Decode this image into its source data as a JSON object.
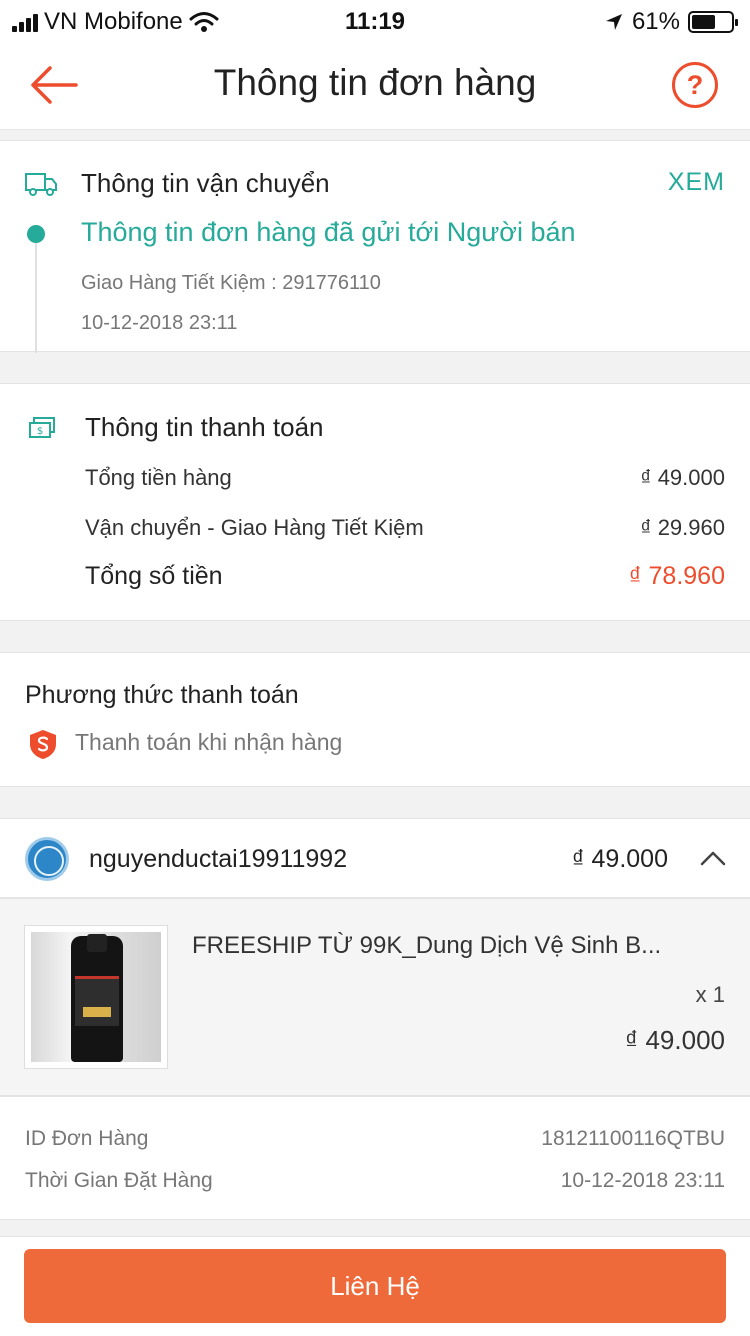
{
  "status_bar": {
    "carrier": "VN Mobifone",
    "time": "11:19",
    "battery": "61%",
    "battery_level": 0.61
  },
  "header": {
    "title": "Thông tin đơn hàng",
    "help_icon": "question-circle-icon",
    "back_icon": "arrow-left-icon"
  },
  "shipping": {
    "title": "Thông tin vận chuyển",
    "view_label": "XEM",
    "status": "Thông tin đơn hàng đã gửi tới Người bán",
    "carrier_line": "Giao Hàng Tiết Kiệm :  291776110",
    "date": "10-12-2018 23:11"
  },
  "payment_info": {
    "title": "Thông tin thanh toán",
    "rows": [
      {
        "label": "Tổng tiền hàng",
        "value": "₫ 49.000"
      },
      {
        "label": "Vận chuyển - Giao Hàng Tiết Kiệm",
        "value": "₫ 29.960"
      },
      {
        "label": "Tổng số tiền",
        "value": "₫ 78.960"
      }
    ]
  },
  "payment_method": {
    "title": "Phương thức thanh toán",
    "value": "Thanh toán khi nhận hàng"
  },
  "shop": {
    "name": "nguyenductai19911992",
    "total": "₫ 49.000"
  },
  "product": {
    "name": "FREESHIP TỪ 99K_Dung Dịch Vệ Sinh B...",
    "quantity": "x 1",
    "price": "₫ 49.000"
  },
  "order_details": {
    "rows": [
      {
        "label": "ID Đơn Hàng",
        "value": "18121100116QTBU"
      },
      {
        "label": "Thời Gian Đặt Hàng",
        "value": "10-12-2018 23:11"
      }
    ]
  },
  "footer": {
    "contact_label": "Liên Hệ"
  },
  "colors": {
    "accent": "#ee4d2d",
    "teal": "#26aa99",
    "button": "#ee6a3a"
  }
}
